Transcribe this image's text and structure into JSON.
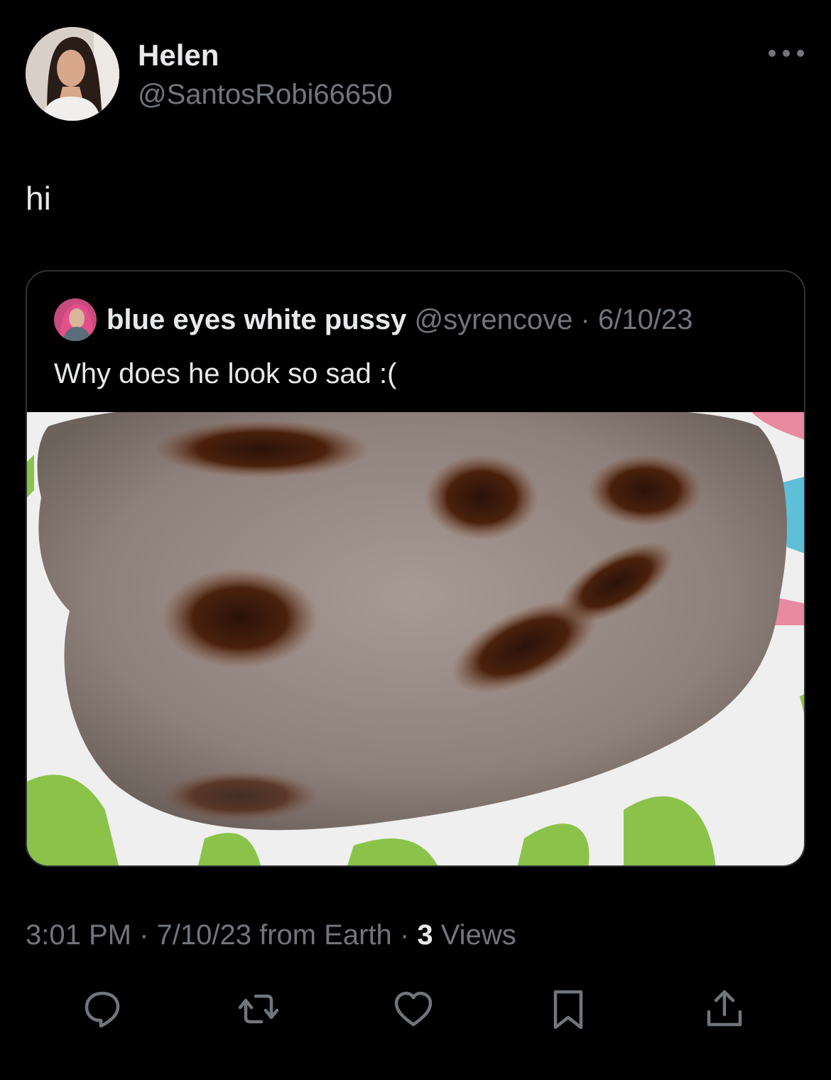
{
  "tweet": {
    "author": {
      "name": "Helen",
      "handle": "@SantosRobi66650"
    },
    "text": "hi",
    "more_icon": "more-horizontal-icon",
    "timestamp": "3:01 PM · 7/10/23 from Earth · ",
    "views_count": "3",
    "views_label": " Views"
  },
  "quote": {
    "author_name": "blue eyes white pussy",
    "meta": " @syrencove · 6/10/23",
    "text": "Why does he look so sad :("
  },
  "actions": [
    {
      "name": "reply",
      "icon": "reply-icon"
    },
    {
      "name": "retweet",
      "icon": "retweet-icon"
    },
    {
      "name": "like",
      "icon": "heart-icon"
    },
    {
      "name": "bookmark",
      "icon": "bookmark-icon"
    },
    {
      "name": "share",
      "icon": "share-icon"
    }
  ],
  "colors": {
    "background": "#000000",
    "primary_text": "#e7e9ea",
    "secondary_text": "#71767b",
    "border": "#2f3336"
  }
}
